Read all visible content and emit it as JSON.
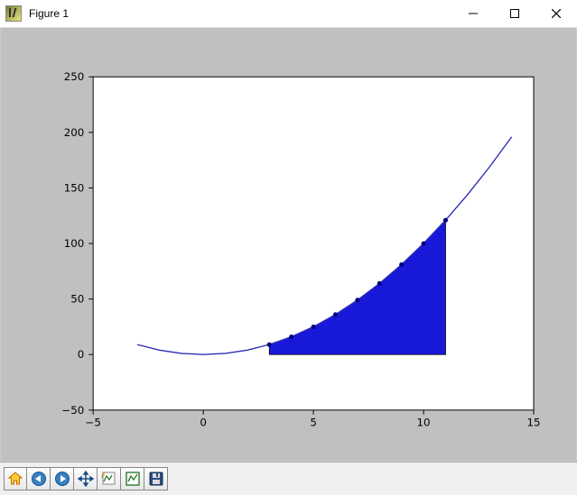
{
  "window": {
    "title": "Figure 1",
    "controls": {
      "minimize": "Minimize",
      "maximize": "Maximize",
      "close": "Close"
    }
  },
  "toolbar": {
    "items": [
      {
        "name": "home-icon",
        "label": "Home"
      },
      {
        "name": "back-icon",
        "label": "Back"
      },
      {
        "name": "forward-icon",
        "label": "Forward"
      },
      {
        "name": "pan-icon",
        "label": "Pan"
      },
      {
        "name": "zoom-icon",
        "label": "Zoom"
      },
      {
        "name": "configure-icon",
        "label": "Configure subplots"
      },
      {
        "name": "save-icon",
        "label": "Save"
      }
    ]
  },
  "chart_data": {
    "type": "line",
    "xlim": [
      -5,
      15
    ],
    "ylim": [
      -50,
      250
    ],
    "xticks": [
      -5,
      0,
      5,
      10,
      15
    ],
    "yticks": [
      -50,
      0,
      50,
      100,
      150,
      200,
      250
    ],
    "xlabel": "",
    "ylabel": "",
    "title": "",
    "series": [
      {
        "name": "curve",
        "color": "#2e2eb8",
        "x": [
          -3,
          -2,
          -1,
          0,
          1,
          2,
          3,
          4,
          5,
          6,
          7,
          8,
          9,
          10,
          11,
          12,
          13,
          14
        ],
        "y": [
          9,
          4,
          1,
          0,
          1,
          4,
          9,
          16,
          25,
          36,
          49,
          64,
          81,
          100,
          121,
          144,
          169,
          196
        ]
      }
    ],
    "markers": {
      "name": "sample-points",
      "color": "#000080",
      "x": [
        3,
        4,
        5,
        6,
        7,
        8,
        9,
        10,
        11
      ],
      "y": [
        9,
        16,
        25,
        36,
        49,
        64,
        81,
        100,
        121
      ]
    },
    "fill": {
      "name": "shaded-region",
      "color": "#1818d8",
      "region": {
        "x_start": 3,
        "x_end": 11,
        "baseline_y": 0,
        "follows_series": "curve"
      }
    }
  }
}
